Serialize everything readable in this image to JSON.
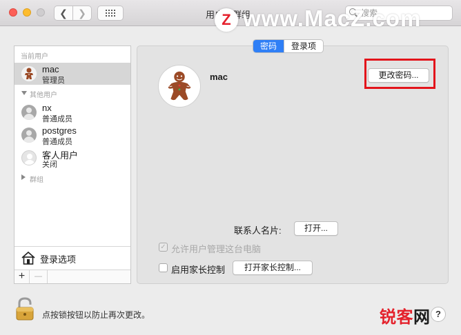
{
  "window": {
    "title": "用户与群组",
    "search_placeholder": "搜索"
  },
  "watermark": {
    "logo_letter": "Z",
    "site": "www.MacZ.com",
    "bottom_red": "锐客",
    "bottom_dark": "网"
  },
  "sidebar": {
    "current_users_label": "当前用户",
    "current_user": {
      "name": "mac",
      "role": "管理员"
    },
    "other_users_label": "其他用户",
    "other_users": [
      {
        "name": "nx",
        "role": "普通成员"
      },
      {
        "name": "postgres",
        "role": "普通成员"
      },
      {
        "name": "客人用户",
        "role": "关闭"
      }
    ],
    "groups_label": "群组",
    "login_options_label": "登录选项",
    "add_label": "+",
    "remove_label": "—"
  },
  "main": {
    "tabs": [
      {
        "label": "密码",
        "active": true
      },
      {
        "label": "登录项",
        "active": false
      }
    ],
    "user_name": "mac",
    "change_password_label": "更改密码...",
    "contact_card_label": "联系人名片:",
    "open_label": "打开...",
    "allow_admin_label": "允许用户管理这台电脑",
    "allow_admin_checked": true,
    "parental_controls_label": "启用家长控制",
    "parental_controls_checked": false,
    "open_parental_label": "打开家长控制..."
  },
  "footer": {
    "lock_text": "点按锁按钮以防止再次更改。",
    "help_label": "?"
  },
  "colors": {
    "accent": "#2f7ff6",
    "highlight_box": "#e3141b",
    "watermark_red": "#e4212b"
  }
}
